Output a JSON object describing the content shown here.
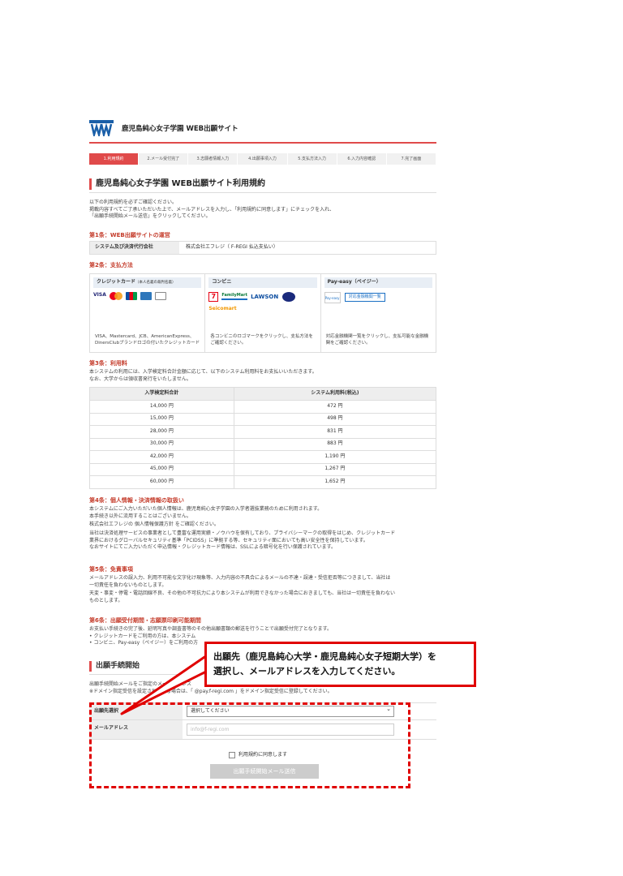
{
  "site": {
    "title": "鹿児島純心女子学園 WEB出願サイト"
  },
  "steps": [
    "1.利用規約",
    "2.メール受付完了",
    "3.志願者情報入力",
    "4.出願事項入力",
    "5.支払方法入力",
    "6.入力内容確認",
    "7.完了画面"
  ],
  "page_title": "鹿児島純心女子学園 WEB出願サイト利用規約",
  "intro": [
    "以下の利用規約を必ずご確認ください。",
    "掲載内容すべてご了承いただいた上で、メールアドレスを入力し、「利用規約に同意します」にチェックを入れ、",
    "「出願手続開始メール送信」をクリックしてください。"
  ],
  "art1": {
    "title": "第1条：WEB出願サイトの運営",
    "label": "システム及び決済代行会社",
    "value": "株式会社エフレジ（ F-REGI 払込支払い）"
  },
  "art2": {
    "title": "第2条：支払方法",
    "credit": {
      "head": "クレジットカード",
      "note": "（本人名義の裁判名義）",
      "visa": "VISA",
      "desc": "VISA、Mastercard、JCB、AmericanExpress、DinersClubブランドロゴの付いたクレジットカード"
    },
    "conv": {
      "head": "コンビニ",
      "seven": "7",
      "fm": "FamilyMart",
      "lawson": "LAWSON",
      "seico": "Seicomart",
      "desc": "各コンビニのロゴマークをクリックし、支払方法をご確認ください。"
    },
    "payeasy": {
      "head": "Pay-easy（ペイジー）",
      "logo": "Pay-easy",
      "btn": "対応金融機関一覧",
      "desc": "対応金融機関一覧をクリックし、支払可能な金融機関をご確認ください。"
    }
  },
  "art3": {
    "title": "第3条：利用料",
    "text": [
      "本システムの利用には、入学検定料合計金額に応じて、以下のシステム利用料をお支払いいただきます。",
      "なお、大学からは領収書発行をいたしません。"
    ],
    "headers": [
      "入学検定料合計",
      "システム利用料(税込)"
    ],
    "rows": [
      [
        "14,000 円",
        "472 円"
      ],
      [
        "15,000 円",
        "498 円"
      ],
      [
        "28,000 円",
        "831 円"
      ],
      [
        "30,000 円",
        "883 円"
      ],
      [
        "42,000 円",
        "1,190 円"
      ],
      [
        "45,000 円",
        "1,267 円"
      ],
      [
        "60,000 円",
        "1,652 円"
      ]
    ]
  },
  "art4": {
    "title": "第4条：個人情報・決済情報の取扱い",
    "text": [
      "本システムにご入力いただいた個人情報は、鹿児島純心女子学園の入学者選抜業務のために利用されます。",
      "本手続き以外に流用することはございません。",
      "株式会社エフレジの 個人情報保護方針 をご確認ください。",
      "当社は決済処理サービスの事業者として豊富な運用実績・ノウハウを保有しており、プライバシーマークの取得をはじめ、クレジットカード",
      "業界におけるグローバルセキュリティ基準「PCIDSS」に準拠する等、セキュリティ面においても高い安全性を保持しています。",
      "なおサイトにてご入力いただく申込情報・クレジットカード情報は、SSLによる暗号化を行い保護されています。"
    ]
  },
  "art5": {
    "title": "第5条：免責事項",
    "text": [
      "メールアドレスの誤入力、利用不可能な文字化け現象等、入力内容の不具合によるメールの不達・誤達・受信拒否等につきまして、当社は",
      "一切責任を負わないものとします。",
      "天変・事変・停電・電話回線不良、その他の不可抗力により本システムが利用できなかった場合におきましても、当社は一切責任を負わない",
      "ものとします。"
    ]
  },
  "art6": {
    "title": "第6条：出願受付期間・志願票印刷可能期間",
    "text": [
      "お支払い手続きの完了後、延明写真や調査書等のその他出願書類の郵送を行うことで出願受付完了となります。",
      "• クレジットカードをご利用の方は、本システム",
      "• コンビニ、Pay-easy（ペイジー）をご利用の方"
    ]
  },
  "form": {
    "title": "出願手続開始",
    "text": [
      "出願手続開始メールをご指定のメールアドレス",
      "※ドメイン指定受信を設定されている場合は、「 @pay.f-regi.com 」をドメイン指定受信に登録してください。"
    ],
    "dest_label": "出願先選択",
    "dest_value": "選択してください",
    "email_label": "メールアドレス",
    "email_placeholder": "info@f-regi.com",
    "agree": "利用規約に同意します",
    "send": "出願手続開始メール送信"
  },
  "callout": {
    "line1": "出願先（鹿児島純心大学・鹿児島純心女子短期大学）を",
    "line2": "選択し、メールアドレスを入力してください。"
  },
  "colors": {
    "accent": "#e04a4a",
    "annotation": "#e00000"
  }
}
